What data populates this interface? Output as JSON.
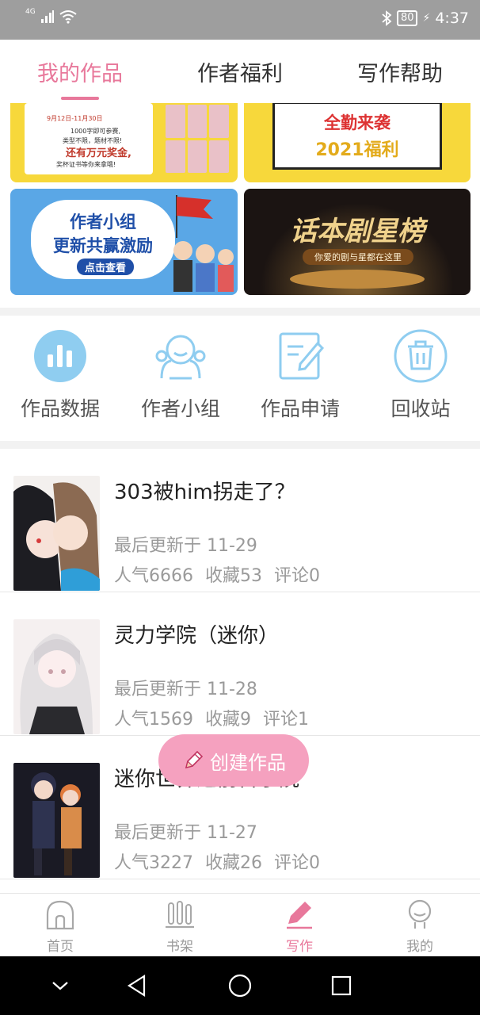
{
  "status_bar": {
    "network": "4G",
    "battery": "80",
    "time": "4:37"
  },
  "tabs": [
    {
      "label": "我的作品",
      "active": true
    },
    {
      "label": "作者福利",
      "active": false
    },
    {
      "label": "写作帮助",
      "active": false
    }
  ],
  "banners": {
    "b1": {
      "date": "9月12日-11月30日",
      "line1": "1000字即可参赛,",
      "line2": "类型不限，题材不限!",
      "headline": "还有万元奖金,",
      "line3": "奖杯证书等你来拿哦!"
    },
    "b2": {
      "title": "全勤来袭",
      "subtitle": "2021福利"
    },
    "b3": {
      "title1": "作者小组",
      "title2": "更新共赢激励",
      "button": "点击查看"
    },
    "b4": {
      "title": "话本剧星榜",
      "subtitle": "你爱的剧与星都在这里"
    }
  },
  "actions": [
    {
      "label": "作品数据",
      "icon": "bar-chart-icon"
    },
    {
      "label": "作者小组",
      "icon": "group-icon"
    },
    {
      "label": "作品申请",
      "icon": "edit-document-icon"
    },
    {
      "label": "回收站",
      "icon": "trash-icon"
    }
  ],
  "works": [
    {
      "title": "303被him拐走了？",
      "updated": "最后更新于 11-29",
      "popularity": "人气6666",
      "favorites": "收藏53",
      "comments": "评论0"
    },
    {
      "title": "灵力学院（迷你）",
      "updated": "最后更新于 11-28",
      "popularity": "人气1569",
      "favorites": "收藏9",
      "comments": "评论1"
    },
    {
      "title": "迷你世界之前哲学院",
      "updated": "最后更新于 11-27",
      "popularity": "人气3227",
      "favorites": "收藏26",
      "comments": "评论0"
    }
  ],
  "fab": {
    "label": "创建作品"
  },
  "bottom_nav": [
    {
      "label": "首页",
      "icon": "home-icon",
      "active": false
    },
    {
      "label": "书架",
      "icon": "bookshelf-icon",
      "active": false
    },
    {
      "label": "写作",
      "icon": "pen-icon",
      "active": true
    },
    {
      "label": "我的",
      "icon": "profile-icon",
      "active": false
    }
  ],
  "colors": {
    "accent": "#e8789b",
    "icon_blue": "#8fcdf0",
    "fab": "#f5a1bf"
  }
}
